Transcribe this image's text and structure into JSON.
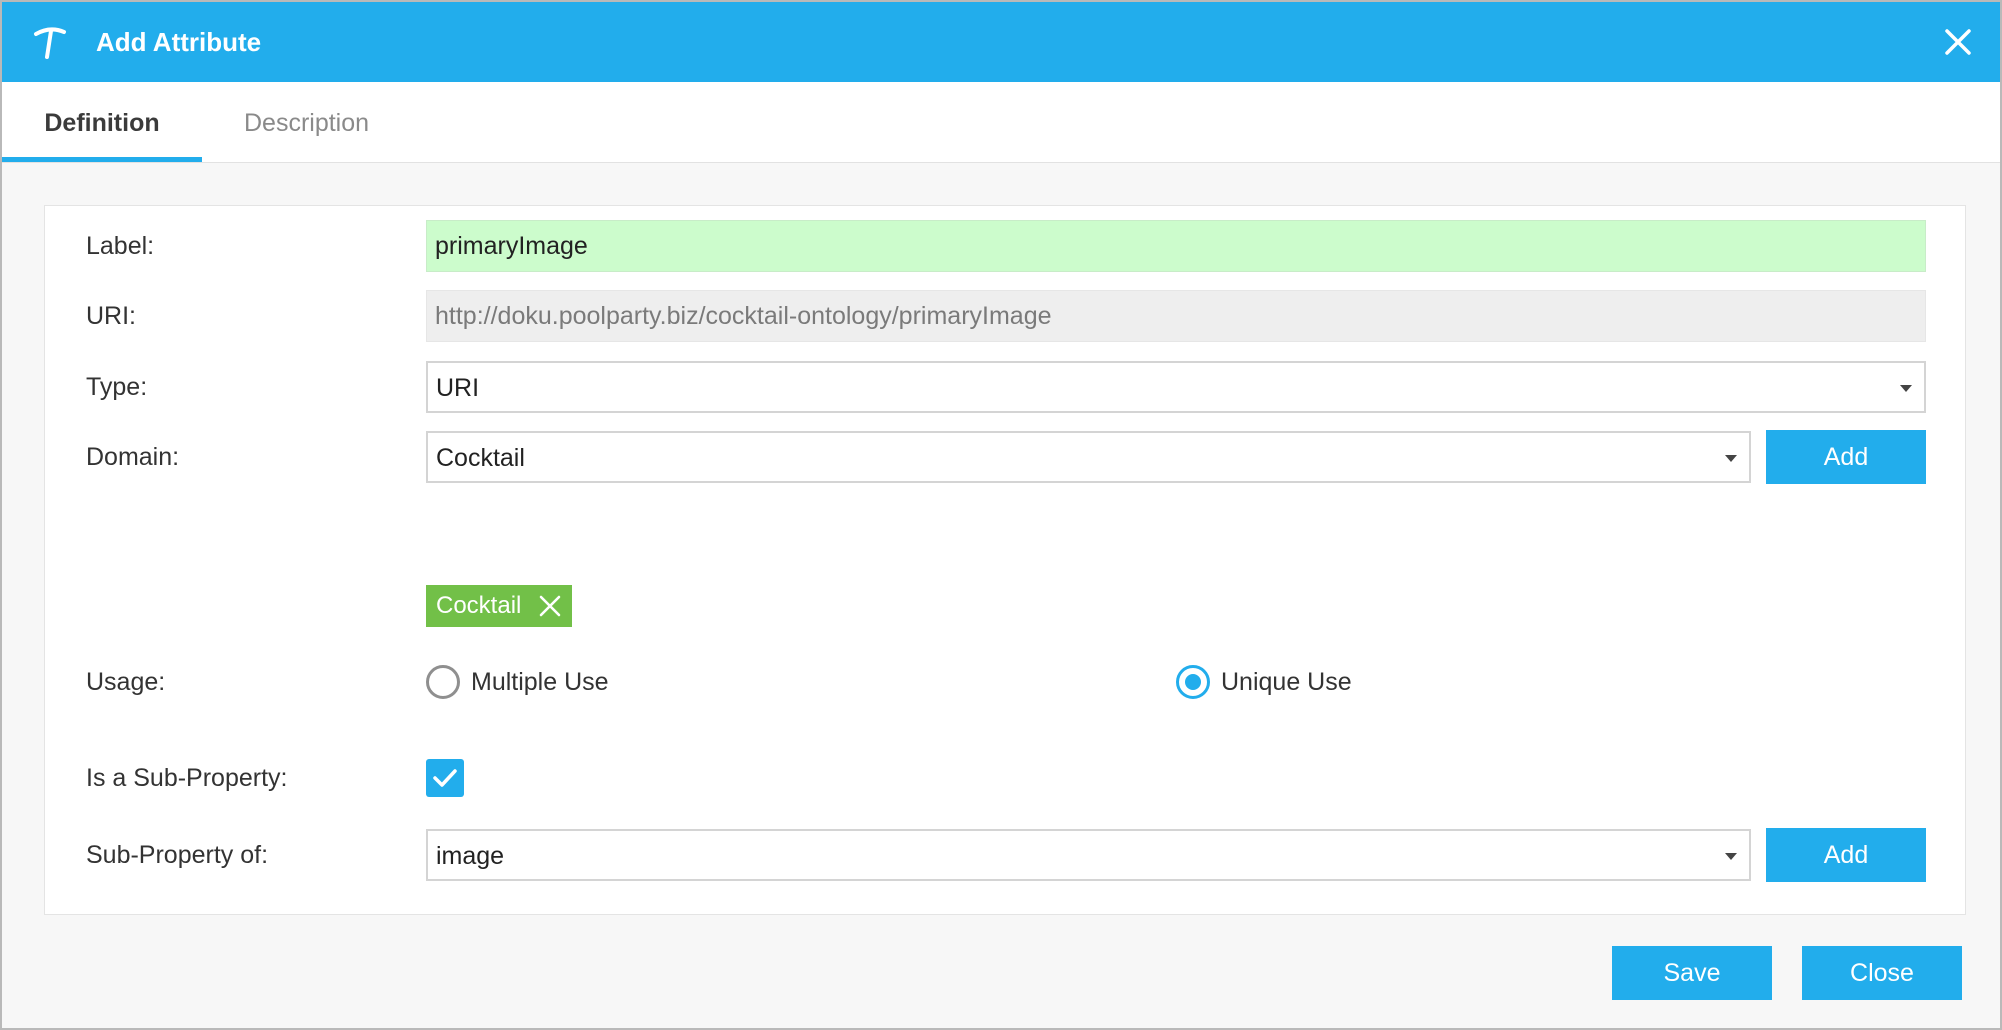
{
  "dialog": {
    "title": "Add Attribute",
    "close_icon": "close-icon",
    "logo_icon": "app-logo-icon"
  },
  "tabs": [
    {
      "label": "Definition",
      "active": true
    },
    {
      "label": "Description",
      "active": false
    }
  ],
  "form": {
    "label": {
      "caption": "Label:",
      "value": "primaryImage"
    },
    "uri": {
      "caption": "URI:",
      "value": "http://doku.poolparty.biz/cocktail-ontology/primaryImage"
    },
    "type": {
      "caption": "Type:",
      "value": "URI"
    },
    "domain": {
      "caption": "Domain:",
      "value": "Cocktail",
      "add_label": "Add",
      "chips": [
        {
          "label": "Cocktail"
        }
      ]
    },
    "usage": {
      "caption": "Usage:",
      "options": [
        {
          "label": "Multiple Use",
          "selected": false
        },
        {
          "label": "Unique Use",
          "selected": true
        }
      ]
    },
    "sub_property": {
      "caption": "Is a Sub-Property:",
      "checked": true
    },
    "sub_property_of": {
      "caption": "Sub-Property of:",
      "value": "image",
      "add_label": "Add"
    }
  },
  "footer": {
    "save_label": "Save",
    "close_label": "Close"
  },
  "colors": {
    "accent": "#22adec",
    "chip": "#72c048",
    "label_field_bg": "#ccfccc"
  }
}
